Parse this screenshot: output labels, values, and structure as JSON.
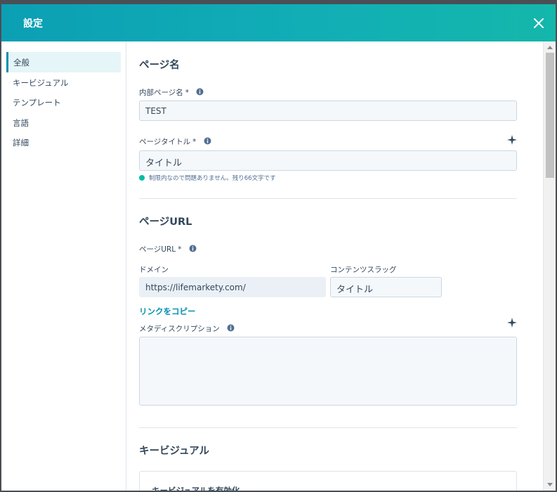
{
  "dialog": {
    "title": "設定"
  },
  "sidebar": {
    "items": [
      {
        "label": "全般",
        "active": true
      },
      {
        "label": "キービジュアル",
        "active": false
      },
      {
        "label": "テンプレート",
        "active": false
      },
      {
        "label": "言語",
        "active": false
      },
      {
        "label": "詳細",
        "active": false
      }
    ]
  },
  "page_name_section": {
    "title": "ページ名",
    "internal_name": {
      "label": "内部ページ名",
      "required_mark": "*",
      "value": "TEST"
    },
    "page_title": {
      "label": "ページタイトル",
      "required_mark": "*",
      "value": "タイトル",
      "hint": "制限内なので問題ありません。残り66文字です"
    }
  },
  "url_section": {
    "title": "ページURL",
    "url_label": "ページURL",
    "required_mark": "*",
    "domain_label": "ドメイン",
    "domain_value": "https://lifemarkety.com/",
    "slug_label": "コンテンツスラッグ",
    "slug_value": "タイトル",
    "copy_link": "リンクをコピー",
    "meta_description_label": "メタディスクリプション",
    "meta_description_value": ""
  },
  "key_visual_section": {
    "title": "キービジュアル",
    "enable_label": "キービジュアルを有効化"
  },
  "colors": {
    "header_gradient_start": "#0b9fb4",
    "header_gradient_end": "#14b7ab",
    "link": "#0091ae",
    "success_dot": "#00bda5",
    "active_nav_bg": "#e5f5f8"
  },
  "icons": [
    "close-icon",
    "info-icon",
    "sparkle-icon"
  ]
}
